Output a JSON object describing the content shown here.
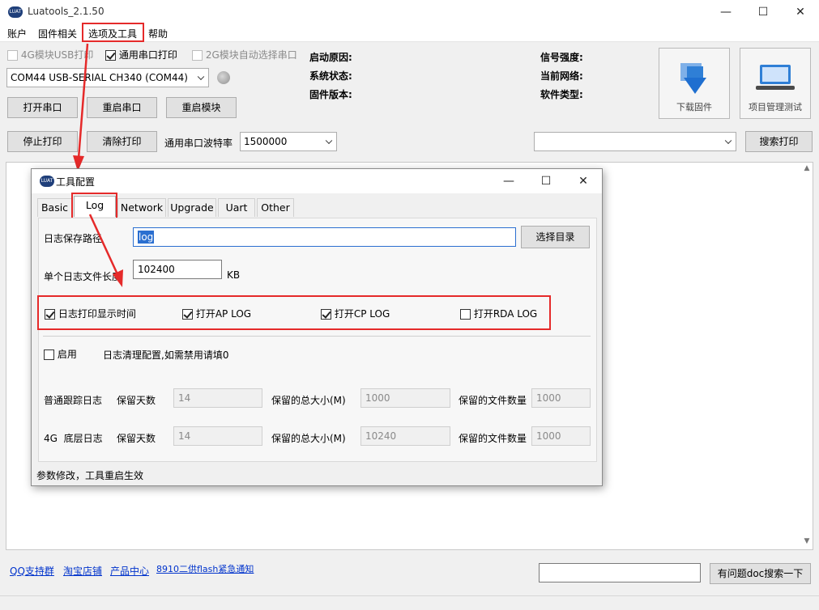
{
  "app": {
    "title": "Luatools_2.1.50",
    "logo_text": "LUAT"
  },
  "window_controls": {
    "minimize": "—",
    "maximize": "☐",
    "close": "✕"
  },
  "menu": {
    "items": [
      "账户",
      "固件相关",
      "选项及工具",
      "帮助"
    ]
  },
  "top": {
    "cb_4g_usb": "4G模块USB打印",
    "cb_uart_print": "通用串口打印",
    "cb_2g_auto": "2G模块自动选择串口",
    "port_value": "COM44 USB-SERIAL CH340 (COM44)",
    "open_port": "打开串口",
    "restart_port": "重启串口",
    "restart_module": "重启模块",
    "stop_print": "停止打印",
    "clear_print": "清除打印",
    "baud_label": "通用串口波特率",
    "baud_value": "1500000",
    "search_value": "",
    "search_print": "搜索打印"
  },
  "status": {
    "boot_reason": "启动原因:",
    "system_status": "系统状态:",
    "firmware_version": "固件版本:",
    "signal_strength": "信号强度:",
    "current_network": "当前网络:",
    "software_type": "软件类型:"
  },
  "big_buttons": {
    "download": "下载固件",
    "project": "项目管理测试"
  },
  "dialog": {
    "title": "工具配置",
    "tabs": [
      "Basic",
      "Log",
      "Network",
      "Upgrade",
      "Uart",
      "Other"
    ],
    "active_tab": "Log",
    "log_path_label": "日志保存路径",
    "log_path_value": "log",
    "choose_dir": "选择目录",
    "max_size_label": "单个日志文件长度",
    "max_size_value": "102400",
    "max_size_unit": "KB",
    "options": [
      {
        "label": "日志打印显示时间",
        "checked": true
      },
      {
        "label": "打开AP LOG",
        "checked": true
      },
      {
        "label": "打开CP LOG",
        "checked": true
      },
      {
        "label": "打开RDA LOG",
        "checked": false
      }
    ],
    "enable_label": "启用",
    "cleanup_note": "日志清理配置,如需禁用请填0",
    "rows": [
      {
        "name": "普通跟踪日志",
        "days_label": "保留天数",
        "days": "14",
        "size_label": "保留的总大小(M)",
        "size": "1000",
        "count_label": "保留的文件数量",
        "count": "1000"
      },
      {
        "name": "4G  底层日志",
        "days_label": "保留天数",
        "days": "14",
        "size_label": "保留的总大小(M)",
        "size": "10240",
        "count_label": "保留的文件数量",
        "count": "1000"
      }
    ],
    "footer_note": "参数修改，工具重启生效"
  },
  "bottom": {
    "links": [
      "QQ支持群",
      "淘宝店铺",
      "产品中心",
      "8910二供flash紧急通知"
    ],
    "doc_search_value": "",
    "doc_search_button": "有问题doc搜索一下"
  },
  "colors": {
    "highlight_red": "#e52a2a",
    "link_blue": "#0033cc"
  }
}
